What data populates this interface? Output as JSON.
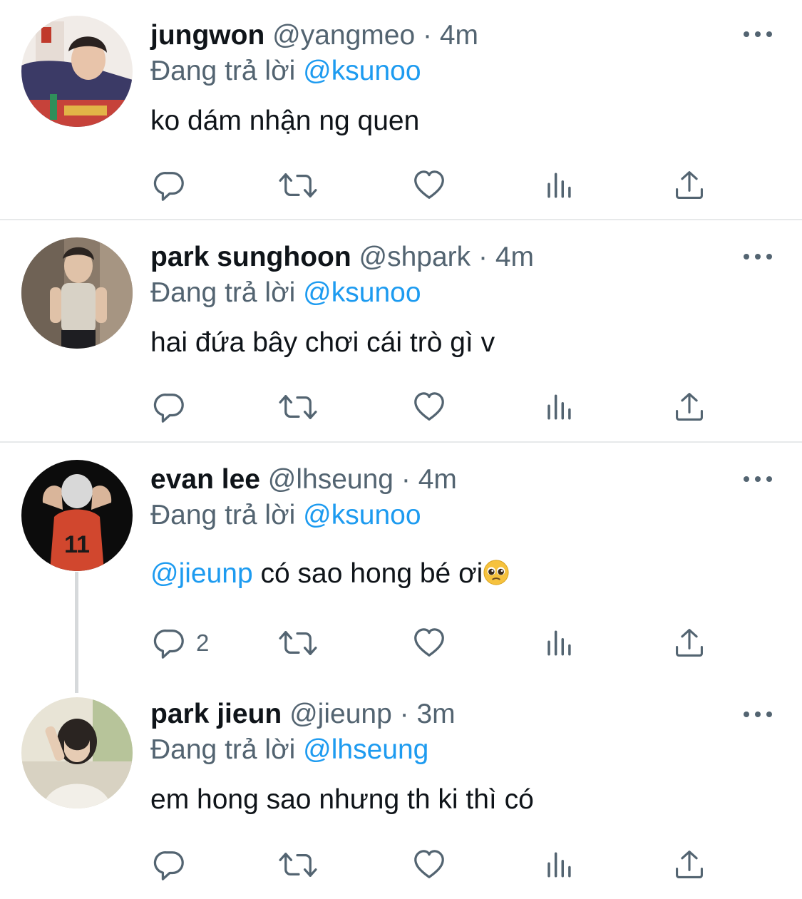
{
  "colors": {
    "mention": "#1d9bf0",
    "secondary": "#536471",
    "primary_text": "#0f1419",
    "divider": "#e7e9ea"
  },
  "tweets": [
    {
      "name": "jungwon",
      "handle": "@yangmeo",
      "separator": "·",
      "time": "4m",
      "reply_prefix": "Đang trả lời",
      "reply_to": "@ksunoo",
      "text": "ko dám nhận ng quen",
      "reply_count": ""
    },
    {
      "name": "park sunghoon",
      "handle": "@shpark",
      "separator": "·",
      "time": "4m",
      "reply_prefix": "Đang trả lời",
      "reply_to": "@ksunoo",
      "text": "hai đứa bây chơi cái trò gì v",
      "reply_count": ""
    },
    {
      "name": "evan lee",
      "handle": "@lhseung",
      "separator": "·",
      "time": "4m",
      "reply_prefix": "Đang trả lời",
      "reply_to": "@ksunoo",
      "text_mention": "@jieunp",
      "text": " có sao hong bé ơi",
      "emoji": "pleading-face-emoji",
      "reply_count": "2"
    },
    {
      "name": "park jieun",
      "handle": "@jieunp",
      "separator": "·",
      "time": "3m",
      "reply_prefix": "Đang trả lời",
      "reply_to": "@lhseung",
      "text": "em hong sao nhưng th ki thì có",
      "reply_count": ""
    }
  ],
  "icons": [
    "reply-icon",
    "retweet-icon",
    "like-icon",
    "analytics-icon",
    "share-icon",
    "more-icon"
  ]
}
